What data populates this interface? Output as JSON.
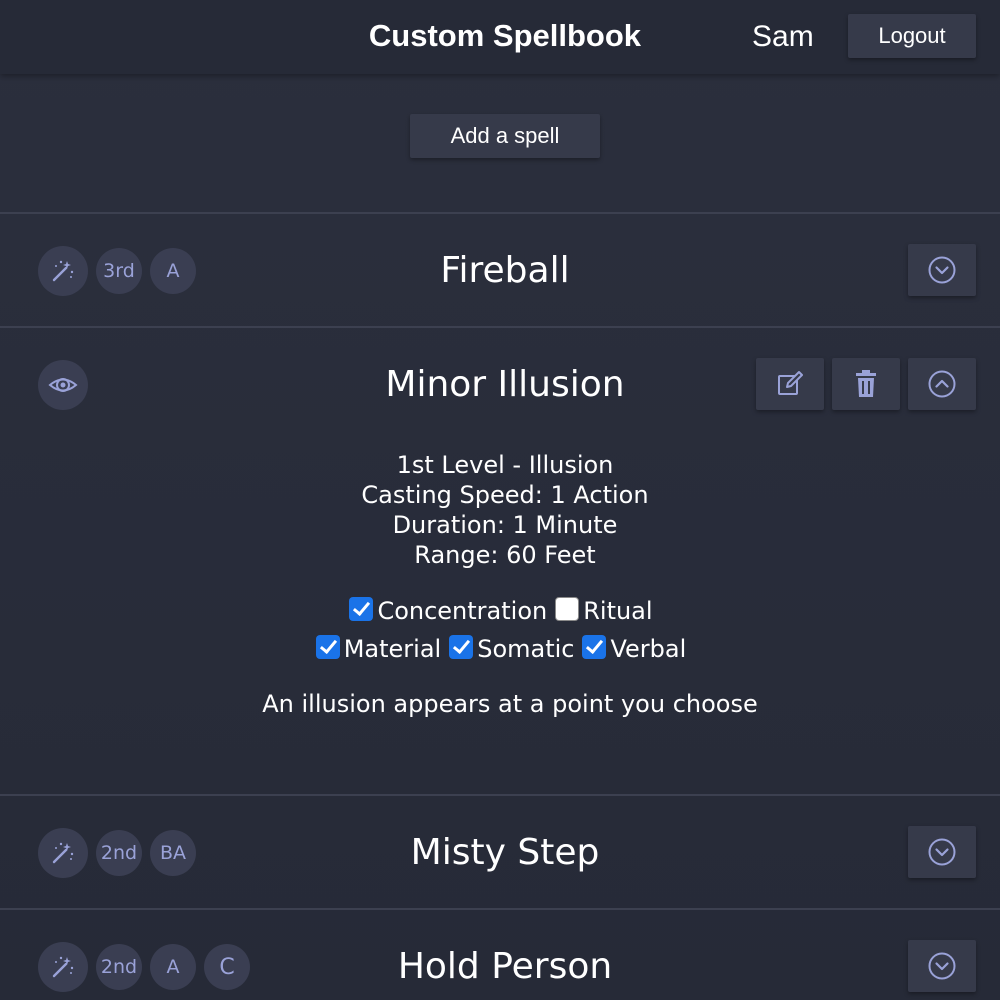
{
  "header": {
    "title": "Custom Spellbook",
    "user": "Sam",
    "logout_label": "Logout"
  },
  "toolbar": {
    "add_spell_label": "Add a spell"
  },
  "spells": [
    {
      "name": "Fireball",
      "icon": "magic-wand-icon",
      "badges": [
        "3rd",
        "A"
      ],
      "expanded": false
    },
    {
      "name": "Minor Illusion",
      "icon": "illusion-eye-icon",
      "badges": [],
      "expanded": true,
      "details": {
        "level_school": "1st Level - Illusion",
        "casting_speed": "Casting Speed: 1 Action",
        "duration": "Duration: 1 Minute",
        "range": "Range: 60 Feet",
        "flags": {
          "concentration": {
            "label": "Concentration",
            "checked": true
          },
          "ritual": {
            "label": "Ritual",
            "checked": false
          },
          "material": {
            "label": "Material",
            "checked": true
          },
          "somatic": {
            "label": "Somatic",
            "checked": true
          },
          "verbal": {
            "label": "Verbal",
            "checked": true
          }
        },
        "description": "An illusion appears at a point you choose"
      }
    },
    {
      "name": "Misty Step",
      "icon": "magic-wand-icon",
      "badges": [
        "2nd",
        "BA"
      ],
      "expanded": false
    },
    {
      "name": "Hold Person",
      "icon": "magic-wand-icon",
      "badges": [
        "2nd",
        "A",
        "C"
      ],
      "expanded": false
    }
  ],
  "colors": {
    "background": "#282c3a",
    "button": "#363a4a",
    "badge": "#3a3e52",
    "accent": "#9aa2d8",
    "checkbox": "#1a73e8"
  }
}
